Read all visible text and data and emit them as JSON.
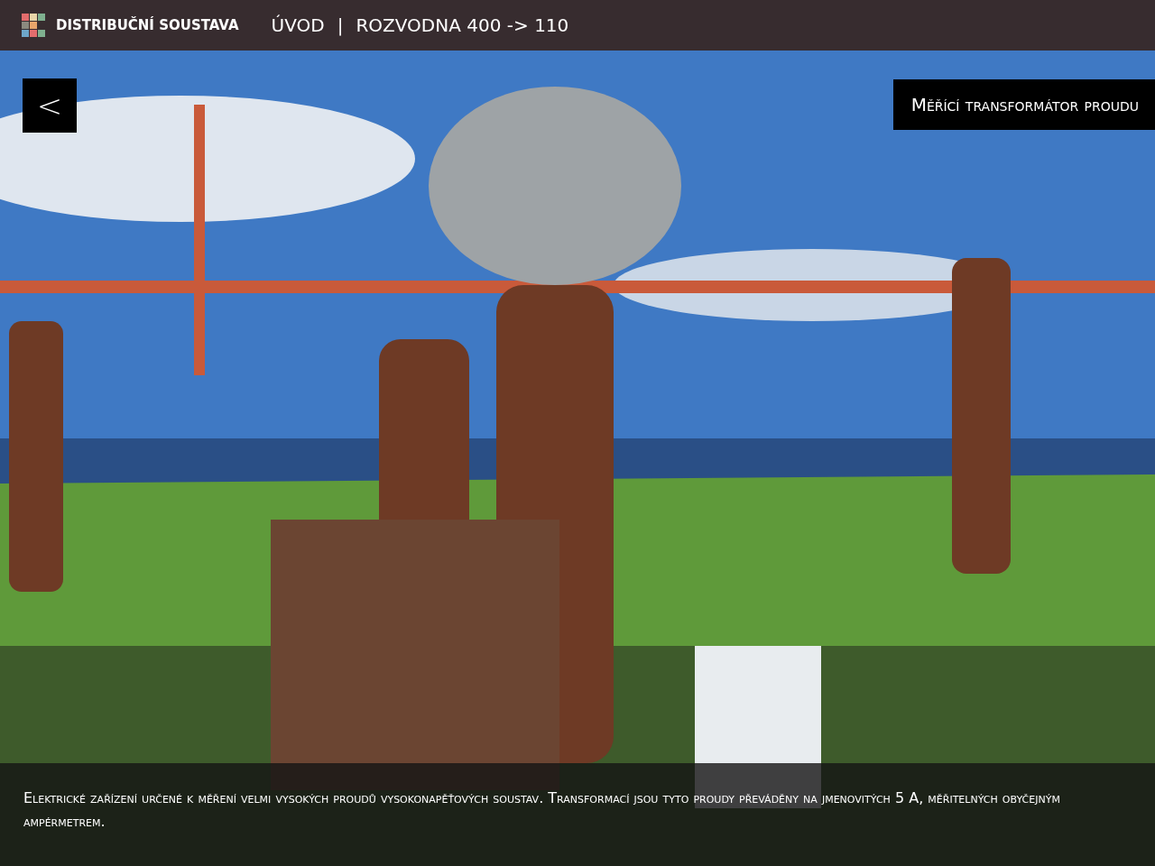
{
  "header": {
    "app_title": "DISTRIBUČNÍ SOUSTAVA",
    "breadcrumb": [
      "ÚVOD",
      "ROZVODNA 400 -> 110"
    ],
    "separator": "|"
  },
  "back_button": {
    "label": "<"
  },
  "title": "Měřící transformátor proudu",
  "description": "Elektrické zařízení určené k měření velmi vysokých proudů vysokonapěťových soustav. Transformací jsou tyto proudy převáděny na jmenovitých 5 A, měřitelných obyčejným ampérmetrem."
}
